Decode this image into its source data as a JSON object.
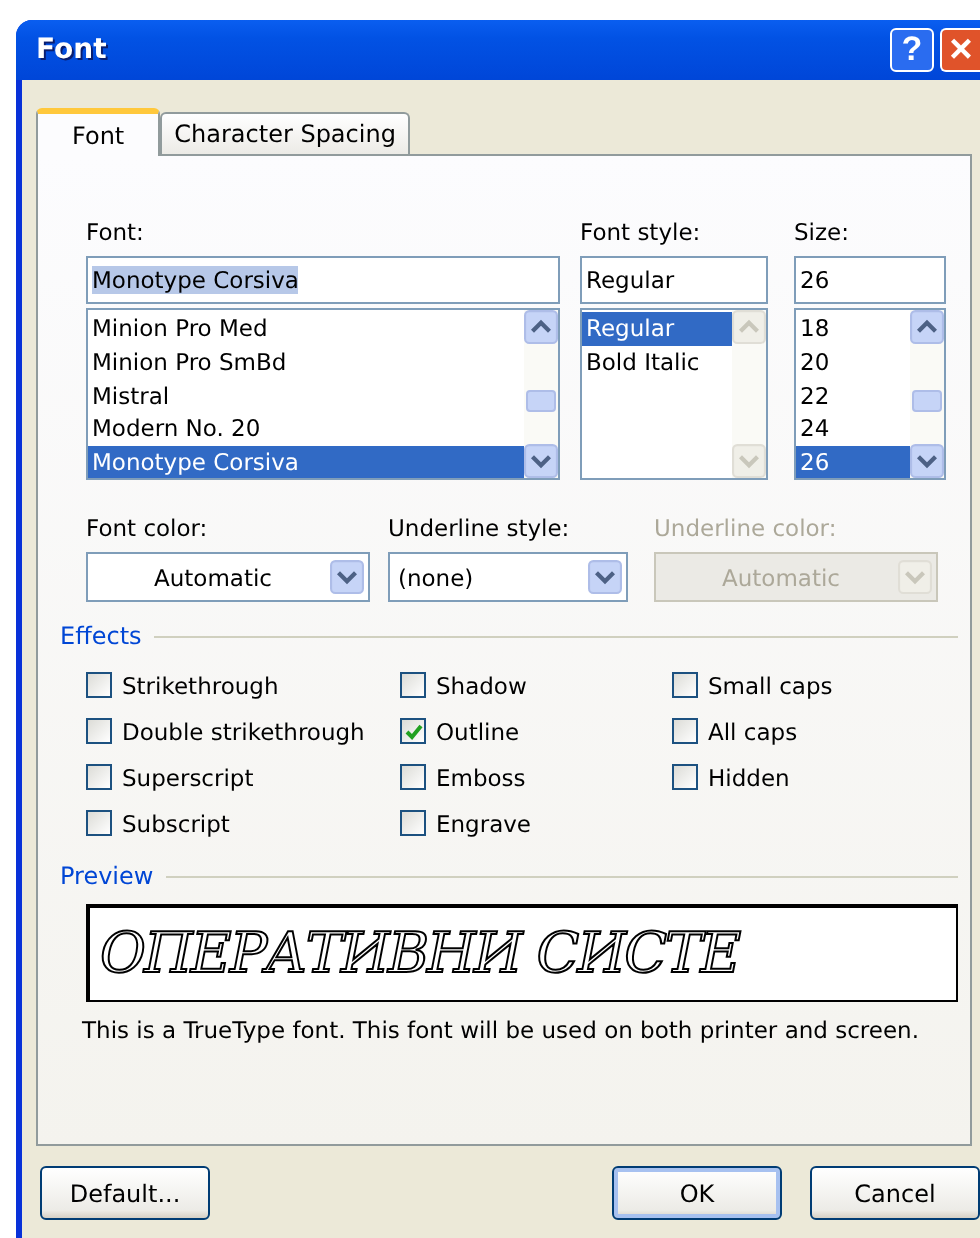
{
  "window": {
    "title": "Font",
    "help": "?",
    "close": "×"
  },
  "tabs": [
    {
      "label": "Font",
      "selected": true
    },
    {
      "label": "Character Spacing",
      "selected": false
    }
  ],
  "font": {
    "label": "Font:",
    "value": "Monotype Corsiva",
    "items": [
      {
        "label": "Minion Pro Med",
        "selected": false
      },
      {
        "label": "Minion Pro SmBd",
        "selected": false
      },
      {
        "label": "Mistral",
        "selected": false
      },
      {
        "label": "Modern No. 20",
        "selected": false
      },
      {
        "label": "Monotype Corsiva",
        "selected": true
      }
    ]
  },
  "font_style": {
    "label": "Font style:",
    "value": "Regular",
    "items": [
      {
        "label": "Regular",
        "selected": true
      },
      {
        "label": "Bold Italic",
        "selected": false
      }
    ]
  },
  "size": {
    "label": "Size:",
    "value": "26",
    "items": [
      {
        "label": "18",
        "selected": false
      },
      {
        "label": "20",
        "selected": false
      },
      {
        "label": "22",
        "selected": false
      },
      {
        "label": "24",
        "selected": false
      },
      {
        "label": "26",
        "selected": true
      }
    ]
  },
  "dropdowns": [
    {
      "label": "Font color:",
      "value": "Automatic",
      "disabled": false,
      "centered": true
    },
    {
      "label": "Underline style:",
      "value": "(none)",
      "disabled": false,
      "centered": false
    },
    {
      "label": "Underline color:",
      "value": "Automatic",
      "disabled": true,
      "centered": true
    }
  ],
  "effects": {
    "title": "Effects",
    "columns": [
      [
        {
          "label": "Strikethrough",
          "checked": false
        },
        {
          "label": "Double strikethrough",
          "checked": false
        },
        {
          "label": "Superscript",
          "checked": false
        },
        {
          "label": "Subscript",
          "checked": false
        }
      ],
      [
        {
          "label": "Shadow",
          "checked": false
        },
        {
          "label": "Outline",
          "checked": true
        },
        {
          "label": "Emboss",
          "checked": false
        },
        {
          "label": "Engrave",
          "checked": false
        }
      ],
      [
        {
          "label": "Small caps",
          "checked": false
        },
        {
          "label": "All caps",
          "checked": false
        },
        {
          "label": "Hidden",
          "checked": false
        }
      ]
    ]
  },
  "preview": {
    "title": "Preview",
    "sample": "ОПЕРАТИВНИ СИСТЕ",
    "note": "This is a TrueType font. This font will be used on both printer and screen."
  },
  "buttons": [
    {
      "label": "Default...",
      "primary": false
    },
    {
      "label": "OK",
      "primary": true
    },
    {
      "label": "Cancel",
      "primary": false
    }
  ]
}
